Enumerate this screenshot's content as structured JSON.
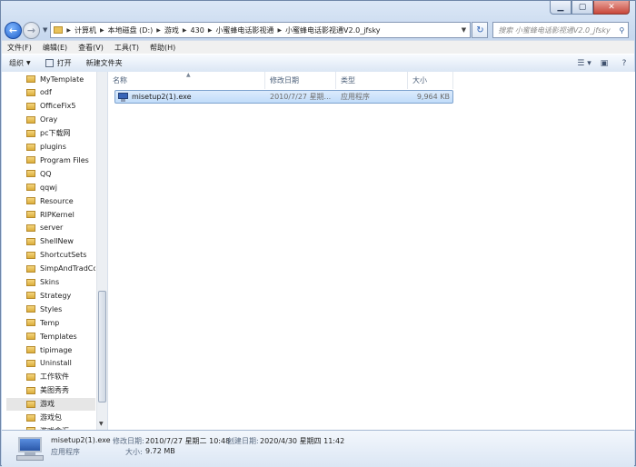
{
  "address": {
    "crumbs": [
      "计算机",
      "本地磁盘 (D:)",
      "游戏",
      "430",
      "小蜜蜂电话影视通",
      "小蜜蜂电话影视通V2.0_jfsky"
    ]
  },
  "search": {
    "placeholder": "搜索 小蜜蜂电话影视通V2.0_jfsky"
  },
  "menu": [
    "文件(F)",
    "编辑(E)",
    "查看(V)",
    "工具(T)",
    "帮助(H)"
  ],
  "toolbar": {
    "organize": "组织",
    "open": "打开",
    "new_folder": "新建文件夹"
  },
  "nav_items": [
    "MyTemplate",
    "odf",
    "OfficeFix5",
    "Oray",
    "pc下载网",
    "plugins",
    "Program Files",
    "QQ",
    "qqwj",
    "Resource",
    "RIPKernel",
    "server",
    "ShellNew",
    "ShortcutSets",
    "SimpAndTradCc",
    "Skins",
    "Strategy",
    "Styles",
    "Temp",
    "Templates",
    "tipimage",
    "Uninstall",
    "工作软件",
    "美图秀秀",
    "游戏",
    "游戏包",
    "游戏盒汇"
  ],
  "selected_nav_index": 24,
  "columns": {
    "name": "名称",
    "modified": "修改日期",
    "type": "类型",
    "size": "大小"
  },
  "files": [
    {
      "name": "misetup2(1).exe",
      "modified": "2010/7/27 星期...",
      "type": "应用程序",
      "size": "9,964 KB"
    }
  ],
  "details": {
    "filename": "misetup2(1).exe",
    "modified_label": "修改日期:",
    "modified": "2010/7/27 星期二 10:48",
    "created_label": "创建日期:",
    "created": "2020/4/30 星期四 11:42",
    "type": "应用程序",
    "size_label": "大小:",
    "size": "9.72 MB"
  }
}
